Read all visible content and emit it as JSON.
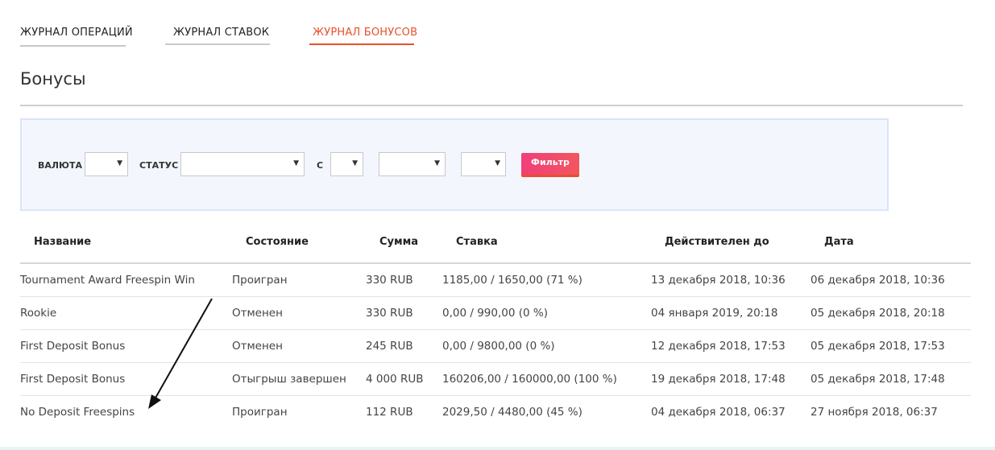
{
  "tabs": [
    {
      "label": "ЖУРНАЛ ОПЕРАЦИЙ",
      "active": false
    },
    {
      "label": "ЖУРНАЛ СТАВОК",
      "active": false
    },
    {
      "label": "ЖУРНАЛ БОНУСОВ",
      "active": true
    }
  ],
  "page": {
    "title": "Бонусы"
  },
  "filter": {
    "currency_label": "ВАЛЮТА",
    "currency_value": "",
    "status_label": "СТАТУС",
    "status_value": "",
    "from_label": "С",
    "day_value": "",
    "month_value": "",
    "year_value": "",
    "button_label": "Фильтр"
  },
  "table": {
    "headers": [
      "Название",
      "Состояние",
      "Сумма",
      "Ставка",
      "Действителен до",
      "Дата"
    ],
    "rows": [
      [
        "Tournament Award Freespin Win",
        "Проигран",
        "330 RUB",
        "1185,00 / 1650,00 (71 %)",
        "13 декабря 2018, 10:36",
        "06 декабря 2018, 10:36"
      ],
      [
        "Rookie",
        "Отменен",
        "330 RUB",
        "0,00 / 990,00 (0 %)",
        "04 января 2019, 20:18",
        "05 декабря 2018, 20:18"
      ],
      [
        "First Deposit Bonus",
        "Отменен",
        "245 RUB",
        "0,00 / 9800,00 (0 %)",
        "12 декабря 2018, 17:53",
        "05 декабря 2018, 17:53"
      ],
      [
        "First Deposit Bonus",
        "Отыгрыш завершен",
        "4 000 RUB",
        "160206,00 / 160000,00 (100 %)",
        "19 декабря 2018, 17:48",
        "05 декабря 2018, 17:48"
      ],
      [
        "No Deposit Freespins",
        "Проигран",
        "112 RUB",
        "2029,50 / 4480,00 (45 %)",
        "04 декабря 2018, 06:37",
        "27 ноября 2018, 06:37"
      ]
    ]
  },
  "colors": {
    "accent": "#e8502a",
    "button_start": "#f03f7b",
    "button_end": "#f2565f",
    "filter_bg": "#f3f6fd"
  },
  "icons": {
    "select_arrow": "triangle-down",
    "annotation": "arrow-pointer"
  }
}
